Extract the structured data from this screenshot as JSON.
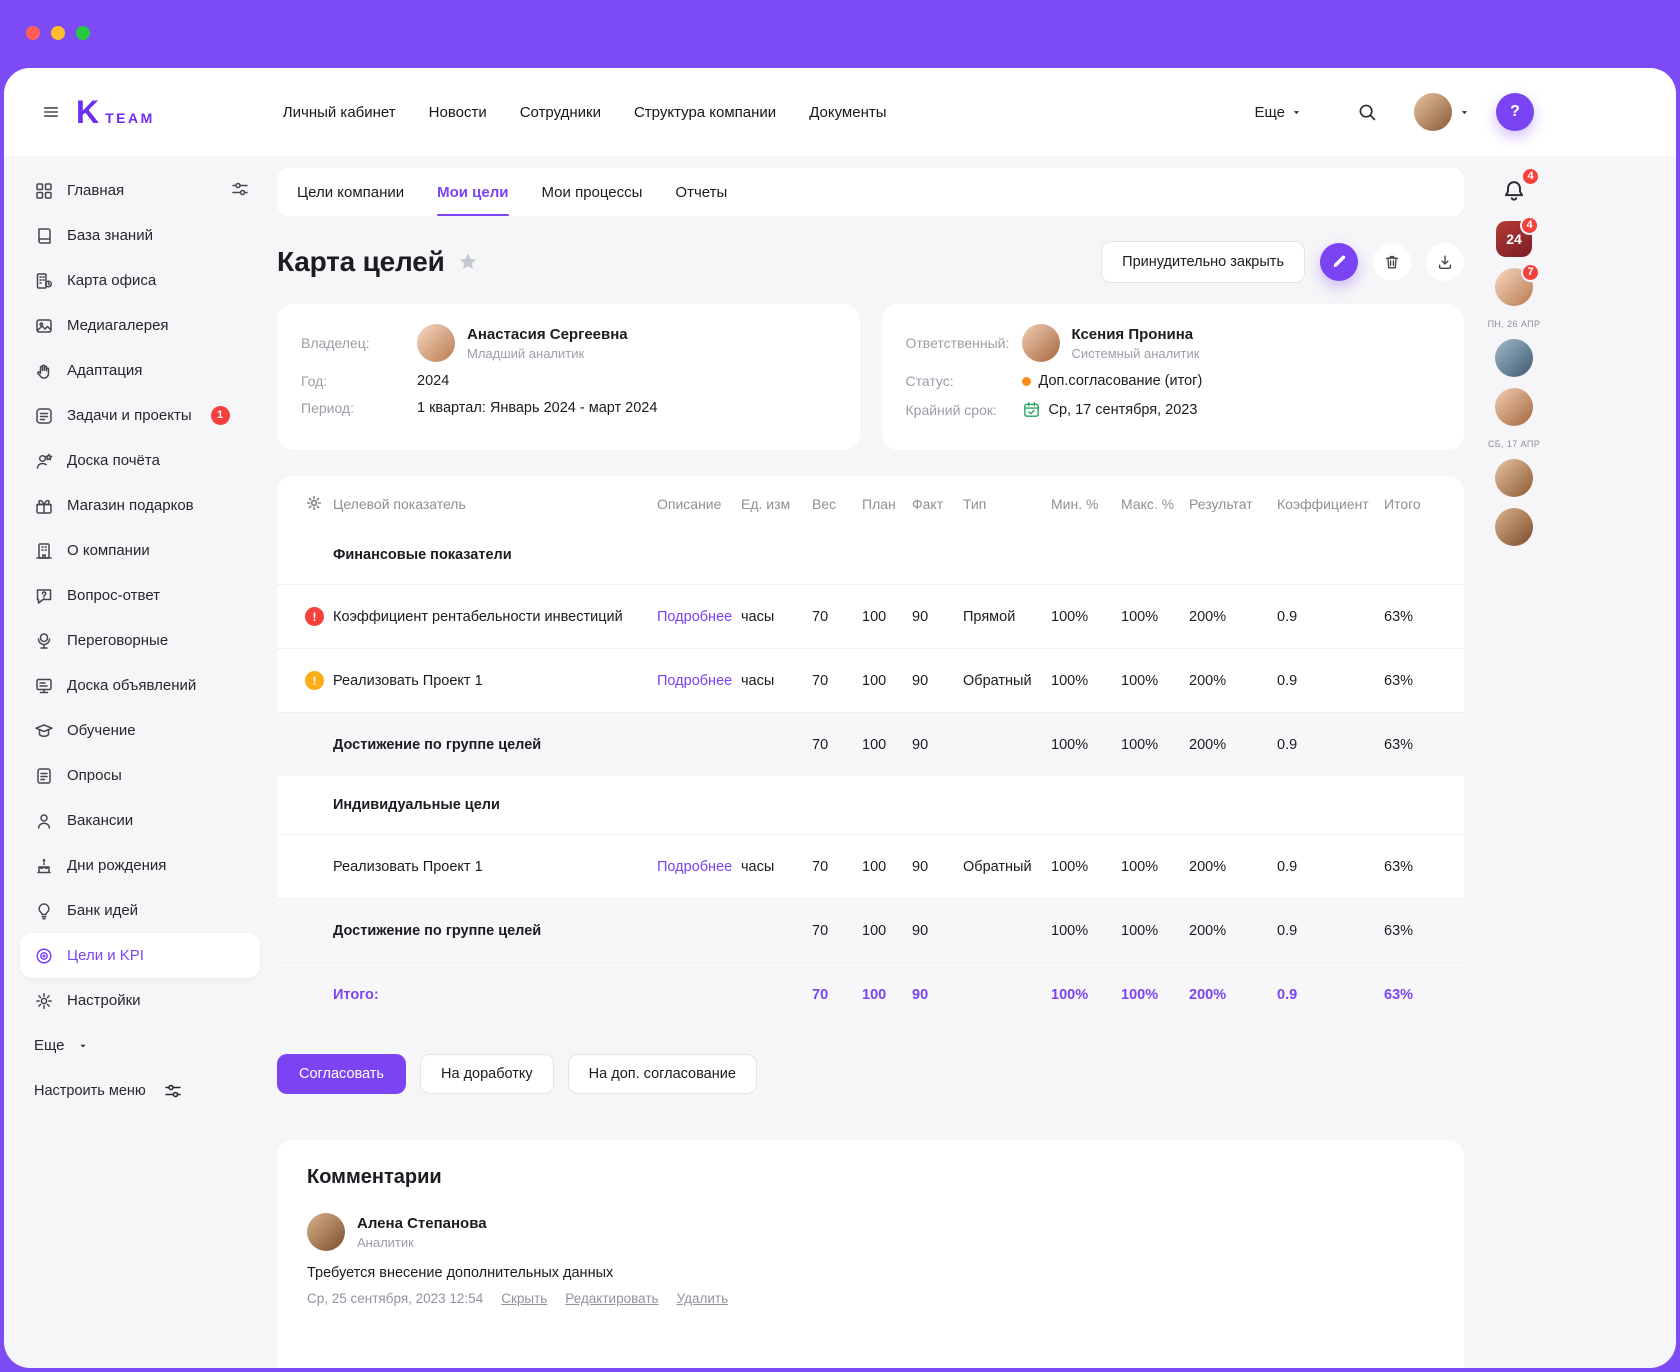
{
  "colors": {
    "accent": "#7B44F2",
    "frame": "#7C4BF5",
    "danger": "#F5413D",
    "warning": "#FAAD14",
    "orange": "#FA8C16",
    "success": "#2BA660"
  },
  "topnav": {
    "brand": {
      "mark": "K",
      "name": "TEAM"
    },
    "items": [
      {
        "id": "personal",
        "label": "Личный кабинет"
      },
      {
        "id": "news",
        "label": "Новости"
      },
      {
        "id": "employees",
        "label": "Сотрудники"
      },
      {
        "id": "structure",
        "label": "Структура компании"
      },
      {
        "id": "documents",
        "label": "Документы"
      }
    ],
    "more_label": "Еще",
    "help_label": "?"
  },
  "sidebar": {
    "items": [
      {
        "id": "home",
        "label": "Главная",
        "icon": "grid",
        "trailing": "sliders"
      },
      {
        "id": "knowledge-base",
        "label": "База знаний",
        "icon": "book"
      },
      {
        "id": "office-map",
        "label": "Карта офиса",
        "icon": "office"
      },
      {
        "id": "media-gallery",
        "label": "Медиагалерея",
        "icon": "image"
      },
      {
        "id": "adaptation",
        "label": "Адаптация",
        "icon": "hands"
      },
      {
        "id": "tasks-projects",
        "label": "Задачи и проекты",
        "icon": "tasks",
        "badge": "1"
      },
      {
        "id": "honor-board",
        "label": "Доска почёта",
        "icon": "user-star"
      },
      {
        "id": "gift-shop",
        "label": "Магазин подарков",
        "icon": "gift"
      },
      {
        "id": "about-company",
        "label": "О компании",
        "icon": "building"
      },
      {
        "id": "qa",
        "label": "Вопрос-ответ",
        "icon": "chat"
      },
      {
        "id": "meeting-rooms",
        "label": "Переговорные",
        "icon": "mic"
      },
      {
        "id": "announcements",
        "label": "Доска объявлений",
        "icon": "board"
      },
      {
        "id": "learning",
        "label": "Обучение",
        "icon": "cap"
      },
      {
        "id": "surveys",
        "label": "Опросы",
        "icon": "survey"
      },
      {
        "id": "vacancies",
        "label": "Вакансии",
        "icon": "user"
      },
      {
        "id": "birthdays",
        "label": "Дни рождения",
        "icon": "cake"
      },
      {
        "id": "idea-bank",
        "label": "Банк идей",
        "icon": "bulb"
      },
      {
        "id": "goals-kpi",
        "label": "Цели и KPI",
        "icon": "target",
        "active": true
      },
      {
        "id": "settings",
        "label": "Настройки",
        "icon": "gear"
      }
    ],
    "more_label": "Еще",
    "customize_label": "Настроить меню"
  },
  "tabs": [
    {
      "id": "company-goals",
      "label": "Цели компании"
    },
    {
      "id": "my-goals",
      "label": "Мои цели",
      "active": true
    },
    {
      "id": "my-processes",
      "label": "Мои процессы"
    },
    {
      "id": "reports",
      "label": "Отчеты"
    }
  ],
  "page": {
    "title": "Карта целей",
    "force_close_label": "Принудительно закрыть"
  },
  "owner_card": {
    "owner_label": "Владелец:",
    "owner_name": "Анастасия Сергеевна",
    "owner_role": "Младший аналитик",
    "year_label": "Год:",
    "year_value": "2024",
    "period_label": "Период:",
    "period_value": "1 квартал: Январь 2024 - март 2024"
  },
  "responsible_card": {
    "label": "Ответственный:",
    "name": "Ксения Пронина",
    "role": "Системный аналитик",
    "status_label": "Статус:",
    "status_value": "Доп.согласование (итог)",
    "deadline_label": "Крайний срок:",
    "deadline_value": "Ср, 17 сентября, 2023"
  },
  "table": {
    "headers": [
      "Целевой показатель",
      "Описание",
      "Ед. изм",
      "Вес",
      "План",
      "Факт",
      "Тип",
      "Мин. %",
      "Макс. %",
      "Результат",
      "Коэффициент",
      "Итого"
    ],
    "rows": [
      {
        "type": "section",
        "name": "Финансовые показатели"
      },
      {
        "type": "data",
        "status": "red",
        "name": "Коэффициент рентабельности инвестиций",
        "details": "Подробнее",
        "unit": "часы",
        "weight": "70",
        "plan": "100",
        "fact": "90",
        "kind": "Прямой",
        "min": "100%",
        "max": "100%",
        "result": "200%",
        "coeff": "0.9",
        "total": "63%"
      },
      {
        "type": "data",
        "status": "yellow",
        "name": "Реализовать Проект 1",
        "details": "Подробнее",
        "unit": "часы",
        "weight": "70",
        "plan": "100",
        "fact": "90",
        "kind": "Обратный",
        "min": "100%",
        "max": "100%",
        "result": "200%",
        "coeff": "0.9",
        "total": "63%"
      },
      {
        "type": "summary",
        "name": "Достижение по группе целей",
        "weight": "70",
        "plan": "100",
        "fact": "90",
        "min": "100%",
        "max": "100%",
        "result": "200%",
        "coeff": "0.9",
        "total": "63%"
      },
      {
        "type": "section",
        "name": "Индивидуальные цели"
      },
      {
        "type": "data",
        "name": "Реализовать Проект 1",
        "details": "Подробнее",
        "unit": "часы",
        "weight": "70",
        "plan": "100",
        "fact": "90",
        "kind": "Обратный",
        "min": "100%",
        "max": "100%",
        "result": "200%",
        "coeff": "0.9",
        "total": "63%"
      },
      {
        "type": "summary",
        "name": "Достижение по группе целей",
        "weight": "70",
        "plan": "100",
        "fact": "90",
        "min": "100%",
        "max": "100%",
        "result": "200%",
        "coeff": "0.9",
        "total": "63%"
      },
      {
        "type": "total",
        "name": "Итого:",
        "weight": "70",
        "plan": "100",
        "fact": "90",
        "min": "100%",
        "max": "100%",
        "result": "200%",
        "coeff": "0.9",
        "total": "63%"
      }
    ]
  },
  "actions": {
    "approve": "Согласовать",
    "rework": "На доработку",
    "extra": "На доп. согласование"
  },
  "comments": {
    "title": "Комментарии",
    "author": "Алена Степанова",
    "role": "Аналитик",
    "text": "Требуется внесение дополнительных данных",
    "time": "Ср, 25 сентября, 2023 12:54",
    "links": [
      {
        "id": "hide",
        "label": "Скрыть"
      },
      {
        "id": "edit",
        "label": "Редактировать"
      },
      {
        "id": "delete",
        "label": "Удалить"
      }
    ]
  },
  "rail": {
    "items": [
      {
        "type": "bell",
        "badge": "4"
      },
      {
        "type": "calendar",
        "day": "24",
        "badge": "4"
      },
      {
        "type": "avatar",
        "badge": "7"
      },
      {
        "type": "label",
        "text": "ПН, 26 АПР"
      },
      {
        "type": "avatar"
      },
      {
        "type": "avatar"
      },
      {
        "type": "label",
        "text": "СБ, 17 АПР"
      },
      {
        "type": "avatar"
      },
      {
        "type": "avatar"
      }
    ]
  }
}
